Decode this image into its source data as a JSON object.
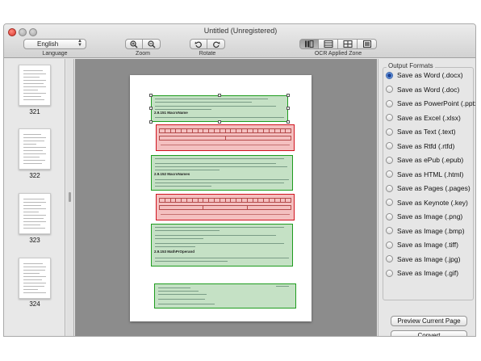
{
  "window": {
    "title": "Untitled (Unregistered)"
  },
  "toolbar": {
    "language_value": "English",
    "language_label": "Language",
    "zoom_label": "Zoom",
    "rotate_label": "Rotate",
    "ocr_zone_label": "OCR Applied Zone",
    "icons": [
      "zoom-in-icon",
      "zoom-out-icon",
      "rotate-left-icon",
      "rotate-right-icon",
      "zone-select-icon",
      "zone-column-icon",
      "zone-table-icon",
      "zone-page-icon"
    ]
  },
  "sidebar": {
    "pages": [
      "321",
      "322",
      "323",
      "324"
    ]
  },
  "document": {
    "zone_colors": {
      "text": "#1f9c1f",
      "table": "#d0141f"
    },
    "headings": [
      "2.9.151 MacroName",
      "2.9.152 MacroNames",
      "2.9.153 MathPrOperand"
    ]
  },
  "panel": {
    "title": "Output Formats",
    "selected": "Save as Word (.docx)",
    "formats": [
      "Save as Word (.docx)",
      "Save as Word (.doc)",
      "Save as PowerPoint (.pptx)",
      "Save as Excel (.xlsx)",
      "Save as Text (.text)",
      "Save as Rtfd (.rtfd)",
      "Save as ePub (.epub)",
      "Save as HTML (.html)",
      "Save as Pages (.pages)",
      "Save as Keynote (.key)",
      "Save as Image (.png)",
      "Save as Image (.bmp)",
      "Save as Image (.tiff)",
      "Save as Image (.jpg)",
      "Save as Image (.gif)"
    ],
    "preview_button": "Preview Current Page",
    "convert_button": "Convert"
  }
}
